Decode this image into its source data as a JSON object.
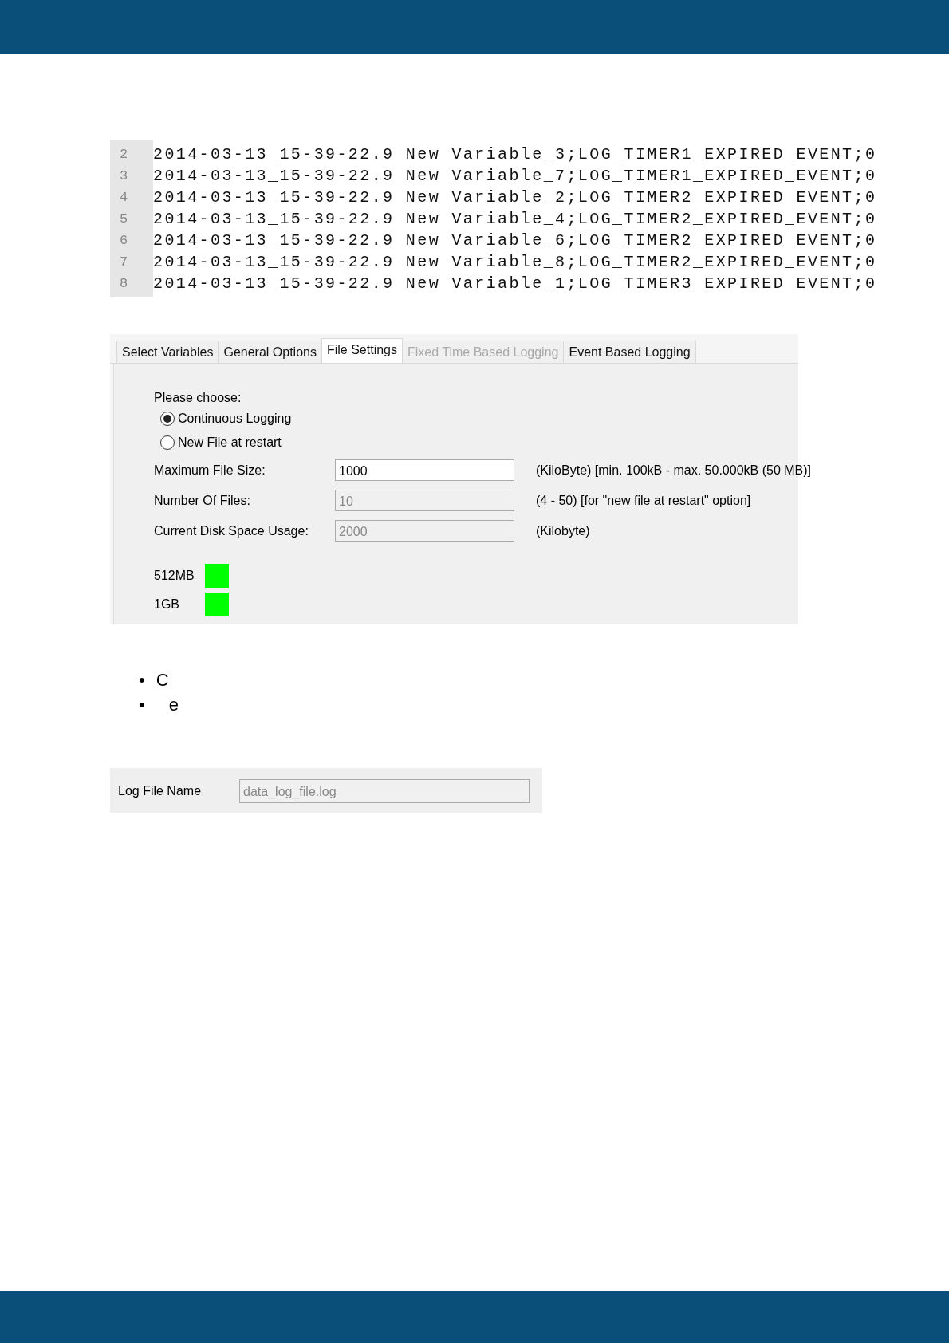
{
  "log_listing": {
    "lines": [
      {
        "number": "2",
        "text": "2014-03-13_15-39-22.9 New Variable_3;LOG_TIMER1_EXPIRED_EVENT;0"
      },
      {
        "number": "3",
        "text": "2014-03-13_15-39-22.9 New Variable_7;LOG_TIMER1_EXPIRED_EVENT;0"
      },
      {
        "number": "4",
        "text": "2014-03-13_15-39-22.9 New Variable_2;LOG_TIMER2_EXPIRED_EVENT;0"
      },
      {
        "number": "5",
        "text": "2014-03-13_15-39-22.9 New Variable_4;LOG_TIMER2_EXPIRED_EVENT;0"
      },
      {
        "number": "6",
        "text": "2014-03-13_15-39-22.9 New Variable_6;LOG_TIMER2_EXPIRED_EVENT;0"
      },
      {
        "number": "7",
        "text": "2014-03-13_15-39-22.9 New Variable_8;LOG_TIMER2_EXPIRED_EVENT;0"
      },
      {
        "number": "8",
        "text": "2014-03-13_15-39-22.9 New Variable_1;LOG_TIMER3_EXPIRED_EVENT;0"
      }
    ]
  },
  "settings_dialog": {
    "tabs": [
      {
        "label": "Select Variables",
        "selected": false,
        "disabled": false
      },
      {
        "label": "General Options",
        "selected": false,
        "disabled": false
      },
      {
        "label": "File Settings",
        "selected": true,
        "disabled": false
      },
      {
        "label": "Fixed Time Based Logging",
        "selected": false,
        "disabled": true
      },
      {
        "label": "Event Based Logging",
        "selected": false,
        "disabled": false
      }
    ],
    "prompt": "Please choose:",
    "radios": [
      {
        "label": "Continuous Logging",
        "selected": true
      },
      {
        "label": "New File at restart",
        "selected": false
      }
    ],
    "fields": [
      {
        "label": "Maximum File Size:",
        "value": "1000",
        "disabled": false,
        "hint": "(KiloByte) [min. 100kB - max. 50.000kB (50 MB)]"
      },
      {
        "label": "Number Of Files:",
        "value": "10",
        "disabled": true,
        "hint": "(4 - 50) [for \"new file at restart\" option]"
      },
      {
        "label": "Current Disk Space Usage:",
        "value": "2000",
        "disabled": true,
        "hint": "(Kilobyte)"
      }
    ],
    "indicators": [
      {
        "label": "512MB",
        "color": "#00ff00"
      },
      {
        "label": "1GB",
        "color": "#00ff00"
      }
    ]
  },
  "bullets": [
    {
      "marker": "•",
      "text": "C"
    },
    {
      "marker": "•",
      "text": "e"
    }
  ],
  "log_file_panel": {
    "label": "Log File Name",
    "value": "data_log_file.log",
    "disabled": true
  }
}
